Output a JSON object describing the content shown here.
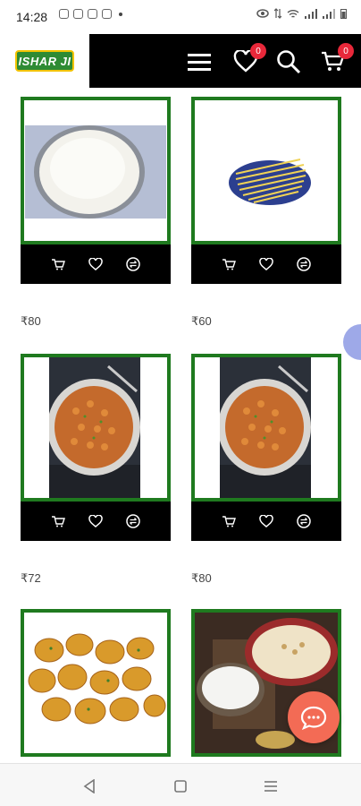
{
  "status_bar": {
    "time": "14:28"
  },
  "header": {
    "logo_text": "ISHAR JI",
    "wishlist_count": "0",
    "cart_count": "0"
  },
  "products": [
    {
      "name": "rice",
      "price": "₹80"
    },
    {
      "name": "noodles",
      "price": "₹60"
    },
    {
      "name": "pasta",
      "price": "₹72"
    },
    {
      "name": "pasta",
      "price": "₹80"
    },
    {
      "name": "roasted potatoes",
      "price": ""
    },
    {
      "name": "kheer",
      "price": ""
    }
  ],
  "colors": {
    "frame": "#1f7a1f",
    "header": "#000000",
    "badge": "#e8283a",
    "chat": "#f36b55"
  },
  "icons": [
    "menu-icon",
    "heart-icon",
    "search-icon",
    "cart-icon",
    "add-to-cart-icon",
    "wishlist-icon",
    "compare-icon",
    "chat-icon"
  ]
}
